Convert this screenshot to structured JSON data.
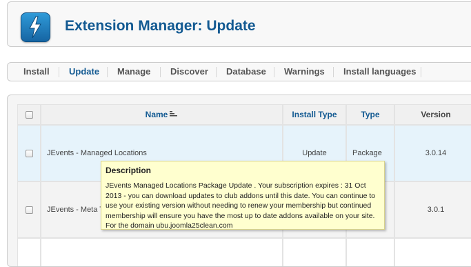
{
  "header": {
    "title": "Extension Manager: Update",
    "logo_icon": "lightning-bolt-icon"
  },
  "tabs": [
    {
      "label": "Install",
      "active": false
    },
    {
      "label": "Update",
      "active": true
    },
    {
      "label": "Manage",
      "active": false
    },
    {
      "label": "Discover",
      "active": false
    },
    {
      "label": "Database",
      "active": false
    },
    {
      "label": "Warnings",
      "active": false
    },
    {
      "label": "Install languages",
      "active": false
    }
  ],
  "table": {
    "columns": {
      "name": "Name",
      "install_type": "Install Type",
      "type": "Type",
      "version": "Version"
    },
    "rows": [
      {
        "name": "JEvents - Managed Locations",
        "install_type": "Update",
        "type": "Package",
        "version": "3.0.14"
      },
      {
        "name": "JEvents - Meta T",
        "install_type": "",
        "type": "",
        "version": "3.0.1"
      }
    ]
  },
  "tooltip": {
    "title": "Description",
    "text": "JEvents Managed Locations Package Update . Your subscription expires : 31 Oct 2013 - you can download updates to club addons until this date. You can continue to use your existing version without needing to renew your membership but continued membership will ensure you have the most up to date addons available on your site. For the domain ubu.joomla25clean.com"
  },
  "colors": {
    "accent": "#135a92",
    "tooltip_bg": "#ffffcf",
    "selected_row": "#e6f3fb"
  }
}
